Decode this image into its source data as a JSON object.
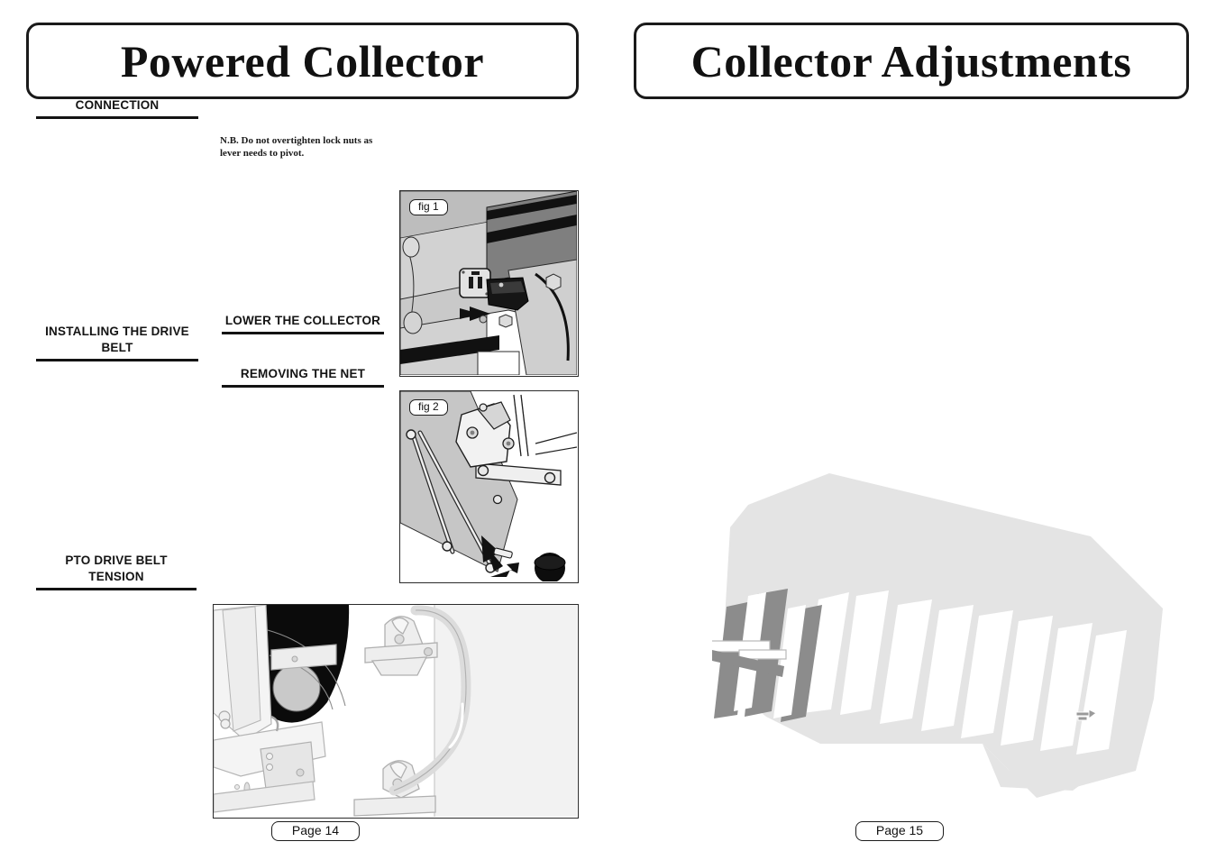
{
  "document": {
    "type": "equipment-operator-manual-spread",
    "background_color": "#ffffff",
    "ink_color": "#111111"
  },
  "left_page": {
    "title": "Powered Collector",
    "page_label": "Page 14",
    "headings": [
      {
        "id": "connection",
        "label": "CONNECTION"
      },
      {
        "id": "installing_belt",
        "label": "INSTALLING THE DRIVE BELT"
      },
      {
        "id": "pto_tension",
        "label": "PTO DRIVE BELT TENSION"
      },
      {
        "id": "lower_collector",
        "label": "LOWER THE COLLECTOR"
      },
      {
        "id": "removing_net",
        "label": "REMOVING THE NET"
      }
    ],
    "note": "N.B. Do not overtighten lock nuts as lever needs  to pivot.",
    "figures": [
      {
        "id": "fig1",
        "label": "fig 1",
        "caption": "",
        "description": "Close-up photo-style line art of the electrical connector socket on the machine frame with an arrow indicating the plug insertion direction."
      },
      {
        "id": "fig2",
        "label": "fig 2",
        "caption": "",
        "description": "Line art of the collector linkage, pivot arm and lock nuts with two arrows showing lever movement, plus a black end cap."
      },
      {
        "id": "fig3",
        "label": "",
        "caption": "",
        "description": "Wide light-tone line drawing of the PTO drive belt, pulley and collector hitch frame."
      }
    ]
  },
  "right_page": {
    "title": "Collector Adjustments",
    "page_label": "Page 15",
    "headings": [],
    "body_text": [],
    "figures": [
      {
        "id": "ghost",
        "label": "",
        "caption": "",
        "description": "Very faint watermark-like grey illustration of the collector rotor with slanted blades/vanes."
      }
    ]
  },
  "colors": {
    "ink": "#111111",
    "rule": "#131313",
    "panel_border": "#2b2b2b",
    "mid_gray": "#a8a8a8",
    "light_gray": "#d8d8d8",
    "ghost_gray": "#e3e3e3",
    "ghost_blade": "#8e8e8e",
    "black": "#000000"
  }
}
